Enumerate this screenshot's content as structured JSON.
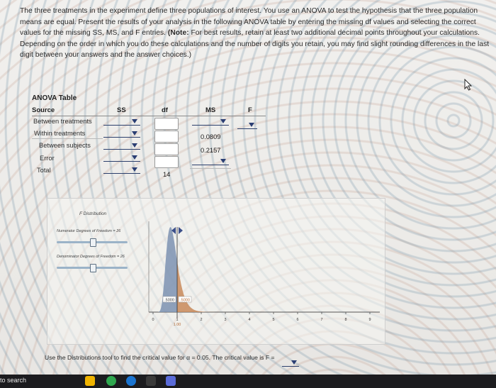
{
  "intro": {
    "text_1": "The three treatments in the experiment define three populations of interest. You use an ANOVA to test the hypothesis that the three population means are equal. Present the results of your analysis in the following ANOVA table by entering the missing df values and selecting the correct values for the missing SS, MS, and F entries. ",
    "note_label": "(Note:",
    "text_2": " For best results, retain at least two additional decimal points throughout your calculations. Depending on the order in which you do these calculations and the number of digits you retain, you may find slight rounding differences in the last digit between your answers and the answer choices.)"
  },
  "anova_table": {
    "title": "ANOVA Table",
    "headers": {
      "source": "Source",
      "ss": "SS",
      "df": "df",
      "ms": "MS",
      "f": "F"
    },
    "rows": {
      "between_treatments": {
        "label": "Between treatments"
      },
      "within_treatments": {
        "label": "Within treatments",
        "ms": "0.0809"
      },
      "between_subjects": {
        "label": "Between subjects",
        "ms": "0.2157"
      },
      "error": {
        "label": "Error"
      },
      "total": {
        "label": "Total",
        "df": "14"
      }
    }
  },
  "distribution_tool": {
    "title": "F Distribution",
    "numerator_label": "Numerator Degrees of Freedom = 26",
    "numerator_df": 26,
    "denominator_label": "Denominator Degrees of Freedom = 26",
    "denominator_df": 26,
    "left_area_label": ".5000",
    "right_area_label": ".5000",
    "marker_label": "1.00",
    "x_ticks": [
      "0",
      "1",
      "2",
      "3",
      "4",
      "5",
      "6",
      "7",
      "8",
      "9"
    ],
    "axis_end_label": "F"
  },
  "question": {
    "text": "Use the Distributions tool to find the critical value for α = 0.05. The critical value is F ="
  },
  "taskbar": {
    "search_label": "to search"
  },
  "colors": {
    "dropdown_arrow": "#2a3e73",
    "curve_left_fill": "#7d92b2",
    "curve_right_fill": "#c98a5b"
  }
}
